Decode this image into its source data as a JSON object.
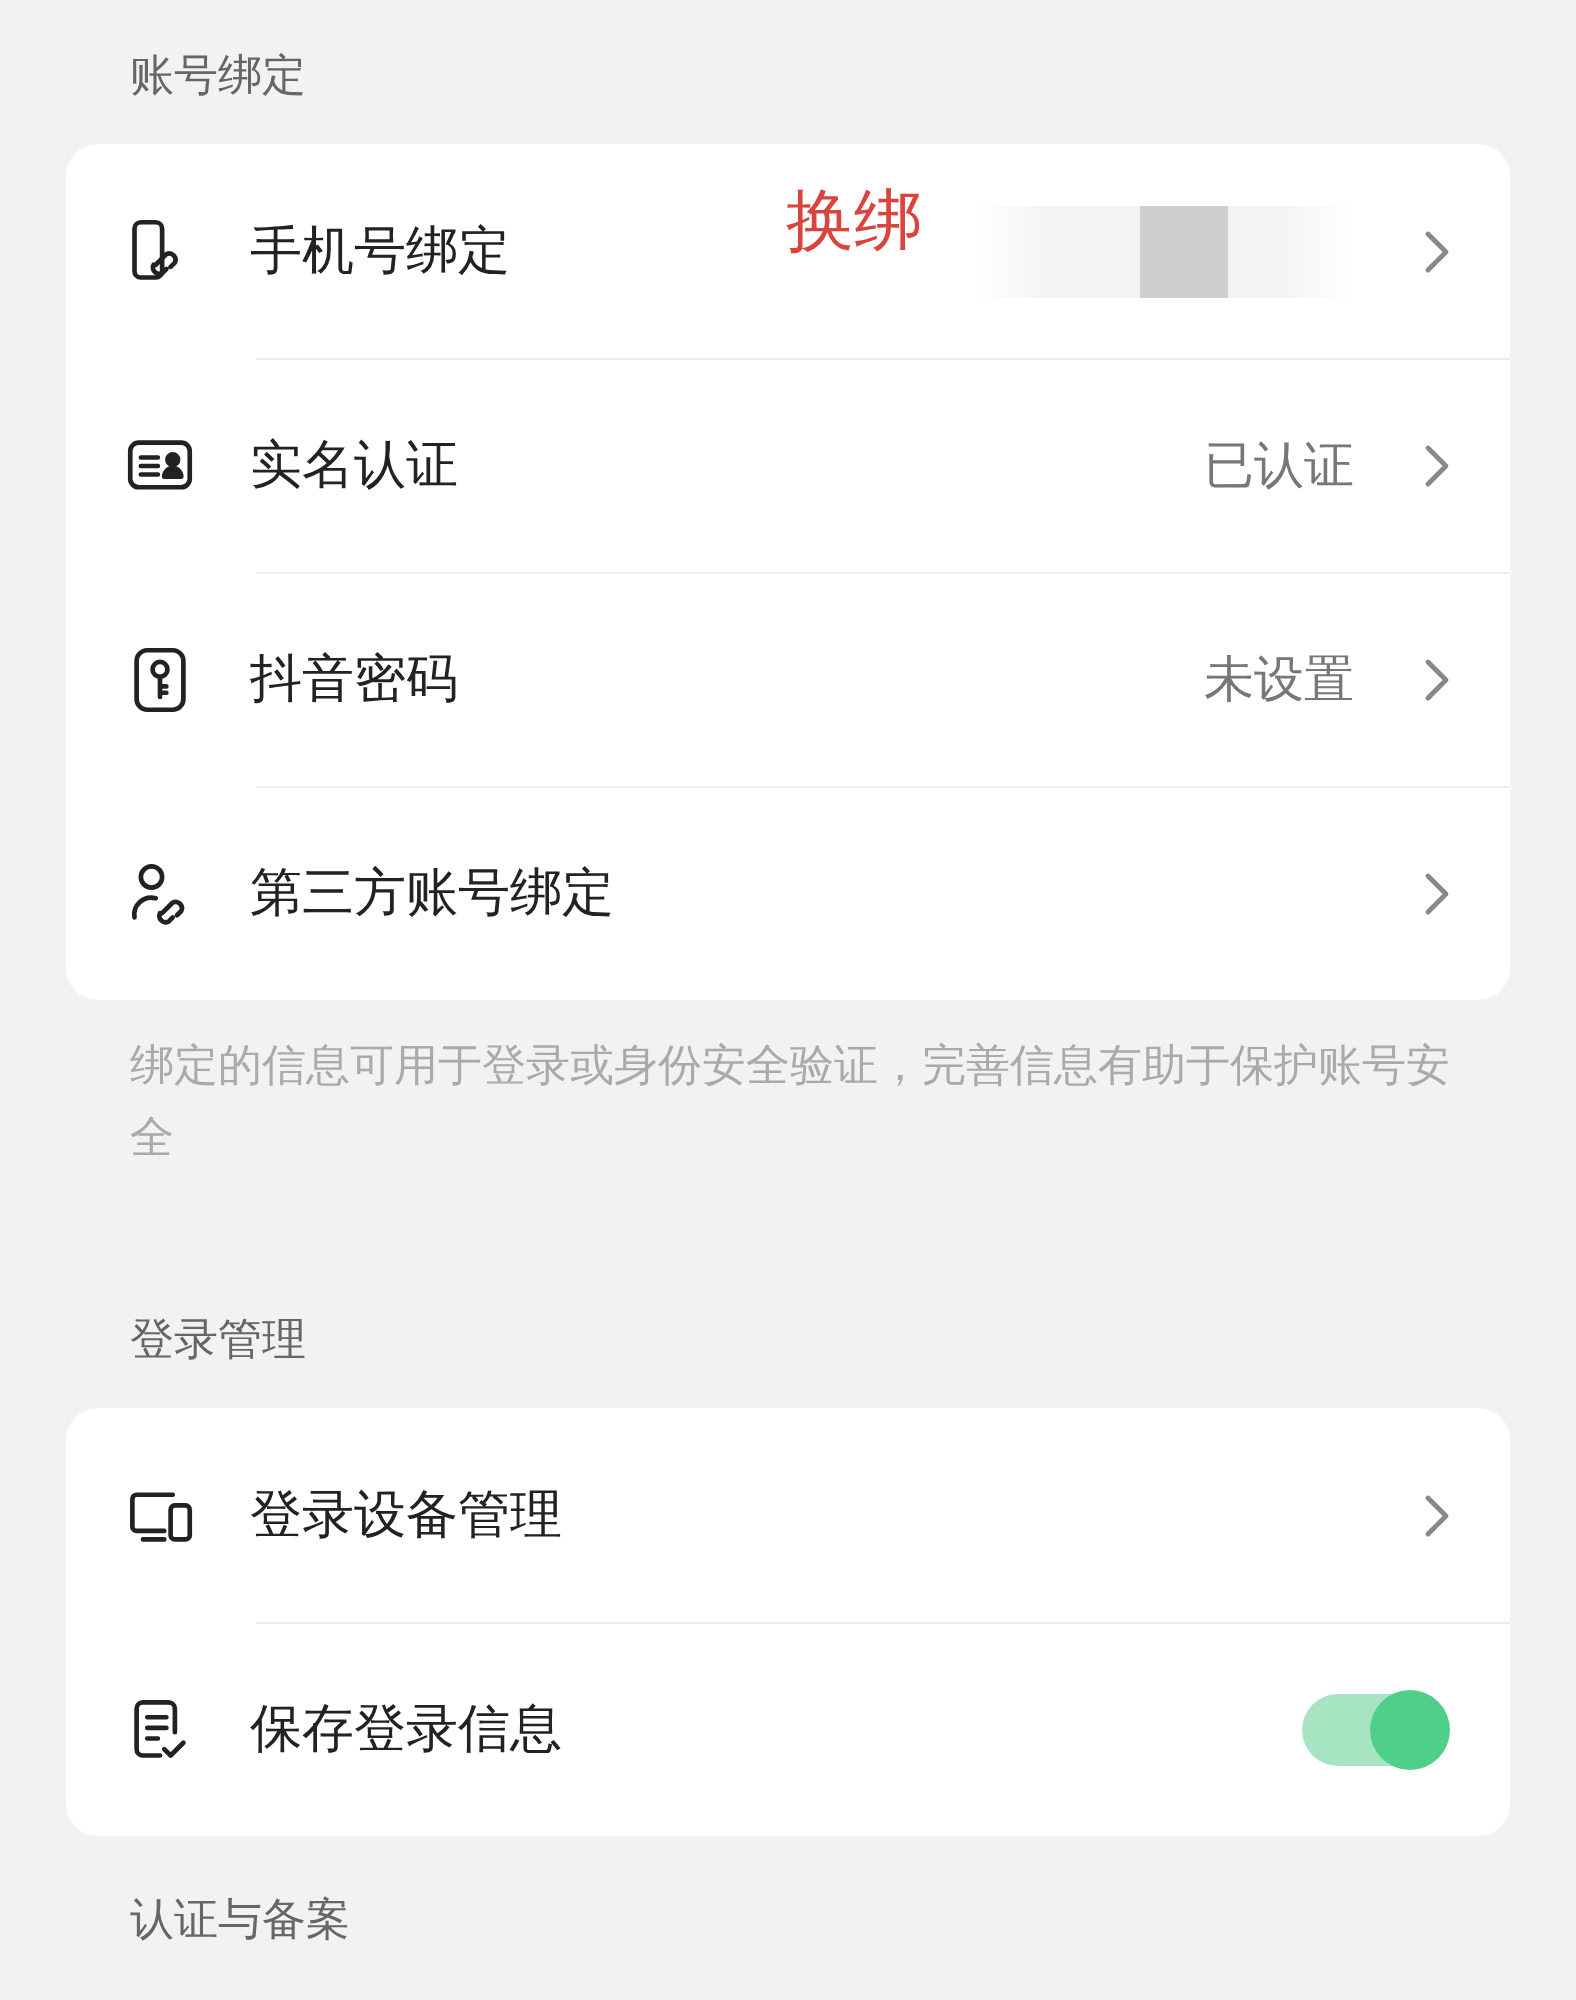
{
  "sections": [
    {
      "title": "账号绑定",
      "items": [
        {
          "kind": "link",
          "label": "手机号绑定",
          "redacted": true,
          "annotation": "换绑"
        },
        {
          "kind": "link",
          "label": "实名认证",
          "value": "已认证"
        },
        {
          "kind": "link",
          "label": "抖音密码",
          "value": "未设置"
        },
        {
          "kind": "link",
          "label": "第三方账号绑定"
        }
      ],
      "note": "绑定的信息可用于登录或身份安全验证，完善信息有助于保护账号安全"
    },
    {
      "title": "登录管理",
      "items": [
        {
          "kind": "link",
          "label": "登录设备管理"
        },
        {
          "kind": "toggle",
          "label": "保存登录信息",
          "on": true
        }
      ]
    },
    {
      "title": "认证与备案"
    }
  ]
}
